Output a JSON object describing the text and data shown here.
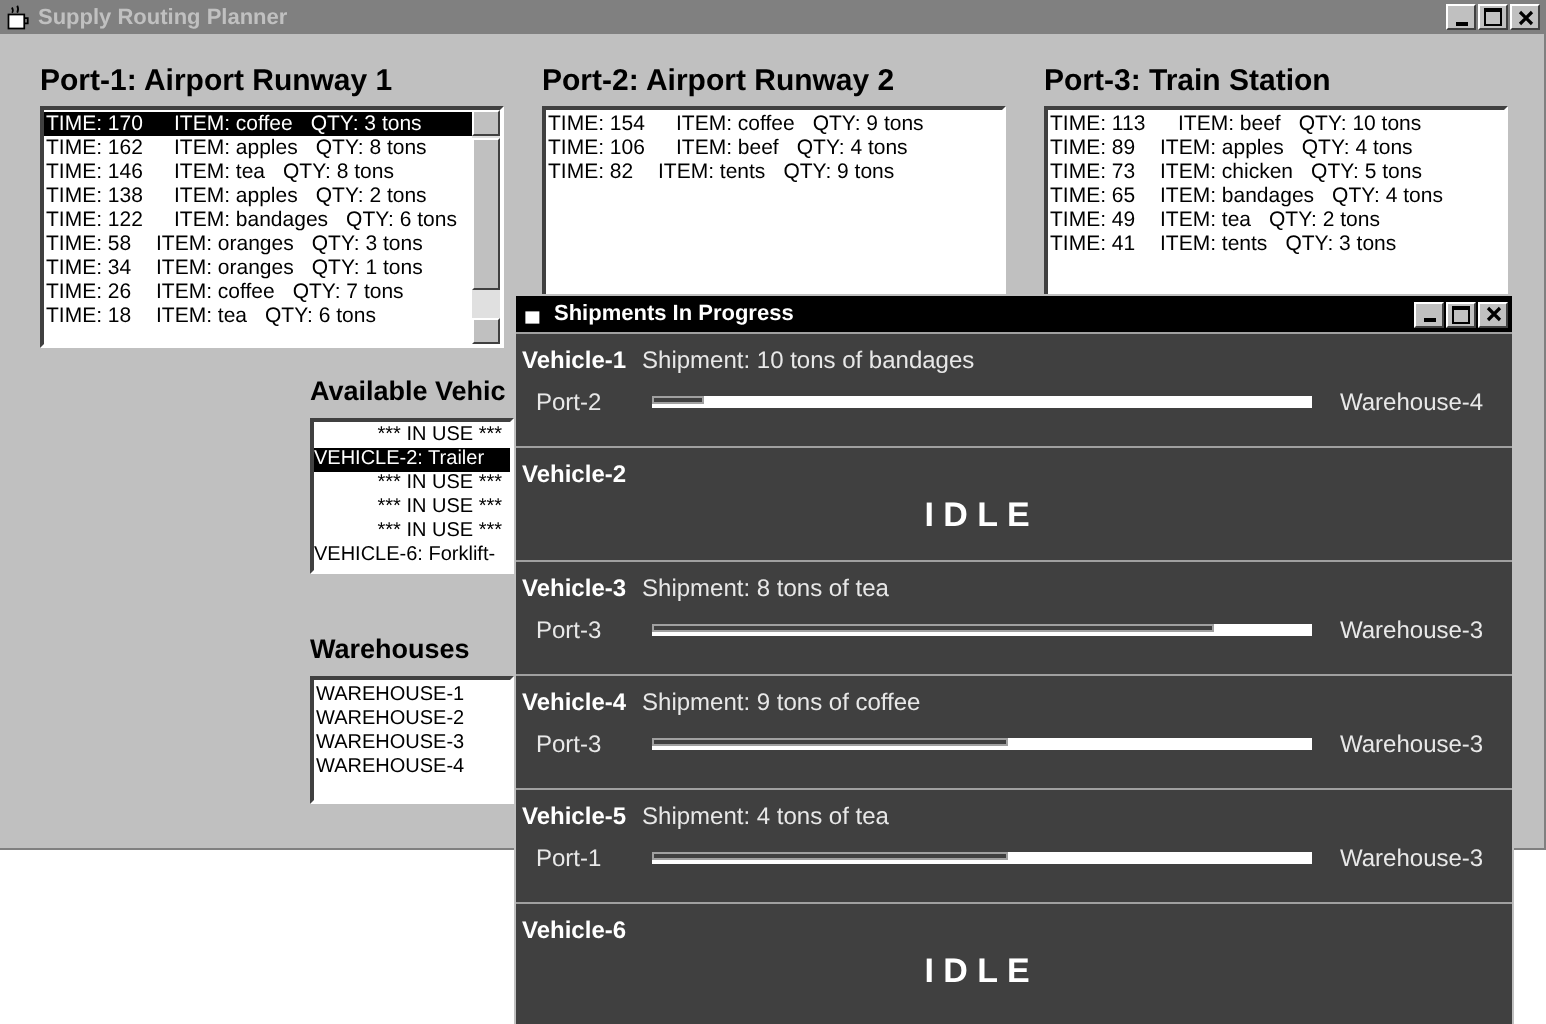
{
  "window": {
    "title": "Supply Routing Planner"
  },
  "ports": [
    {
      "title": "Port-1: Airport Runway 1",
      "scrollable": true,
      "rows": [
        {
          "time": "TIME: 170",
          "item": "ITEM: coffee",
          "qty": "QTY: 3 tons",
          "selected": true
        },
        {
          "time": "TIME: 162",
          "item": "ITEM: apples",
          "qty": "QTY: 8 tons",
          "selected": false
        },
        {
          "time": "TIME: 146",
          "item": "ITEM: tea",
          "qty": "QTY: 8 tons",
          "selected": false
        },
        {
          "time": "TIME: 138",
          "item": "ITEM: apples",
          "qty": "QTY: 2 tons",
          "selected": false
        },
        {
          "time": "TIME: 122",
          "item": "ITEM: bandages",
          "qty": "QTY: 6 tons",
          "selected": false
        },
        {
          "time": "TIME: 58",
          "item": "ITEM: oranges",
          "qty": "QTY: 3 tons",
          "selected": false
        },
        {
          "time": "TIME: 34",
          "item": "ITEM: oranges",
          "qty": "QTY: 1 tons",
          "selected": false
        },
        {
          "time": "TIME: 26",
          "item": "ITEM: coffee",
          "qty": "QTY: 7 tons",
          "selected": false
        },
        {
          "time": "TIME: 18",
          "item": "ITEM: tea",
          "qty": "QTY: 6 tons",
          "selected": false
        }
      ]
    },
    {
      "title": "Port-2: Airport Runway 2",
      "scrollable": false,
      "rows": [
        {
          "time": "TIME: 154",
          "item": "ITEM: coffee",
          "qty": "QTY: 9 tons",
          "selected": false
        },
        {
          "time": "TIME: 106",
          "item": "ITEM: beef",
          "qty": "QTY: 4 tons",
          "selected": false
        },
        {
          "time": "TIME: 82",
          "item": "ITEM: tents",
          "qty": "QTY: 9 tons",
          "selected": false
        }
      ]
    },
    {
      "title": "Port-3: Train Station",
      "scrollable": false,
      "rows": [
        {
          "time": "TIME: 113",
          "item": "ITEM: beef",
          "qty": "QTY: 10 tons",
          "selected": false
        },
        {
          "time": "TIME: 89",
          "item": "ITEM: apples",
          "qty": "QTY: 4 tons",
          "selected": false
        },
        {
          "time": "TIME: 73",
          "item": "ITEM: chicken",
          "qty": "QTY: 5 tons",
          "selected": false
        },
        {
          "time": "TIME: 65",
          "item": "ITEM: bandages",
          "qty": "QTY: 4 tons",
          "selected": false
        },
        {
          "time": "TIME: 49",
          "item": "ITEM: tea",
          "qty": "QTY: 2 tons",
          "selected": false
        },
        {
          "time": "TIME: 41",
          "item": "ITEM: tents",
          "qty": "QTY: 3 tons",
          "selected": false
        }
      ]
    }
  ],
  "vehicles": {
    "title": "Available Vehic",
    "items": [
      {
        "kind": "in_use",
        "label": "*** IN USE ***",
        "selected": false
      },
      {
        "kind": "vehicle",
        "label": "VEHICLE-2: Trailer",
        "selected": true
      },
      {
        "kind": "in_use",
        "label": "*** IN USE ***",
        "selected": false
      },
      {
        "kind": "in_use",
        "label": "*** IN USE ***",
        "selected": false
      },
      {
        "kind": "in_use",
        "label": "*** IN USE ***",
        "selected": false
      },
      {
        "kind": "vehicle",
        "label": "VEHICLE-6: Forklift-",
        "selected": false
      }
    ]
  },
  "warehouses": {
    "title": "Warehouses",
    "items": [
      "WAREHOUSE-1",
      "WAREHOUSE-2",
      "WAREHOUSE-3",
      "WAREHOUSE-4"
    ]
  },
  "shipments_window": {
    "title": "Shipments In Progress",
    "vehicles": [
      {
        "kind": "moving",
        "name": "Vehicle-1",
        "shipment": "Shipment: 10 tons of bandages",
        "from": "Port-2",
        "to": "Warehouse-4",
        "level": 0.08
      },
      {
        "kind": "idle",
        "name": "Vehicle-2",
        "status": "I D L E"
      },
      {
        "kind": "moving",
        "name": "Vehicle-3",
        "shipment": "Shipment: 8 tons of tea",
        "from": "Port-3",
        "to": "Warehouse-3",
        "level": 0.85
      },
      {
        "kind": "moving",
        "name": "Vehicle-4",
        "shipment": "Shipment: 9 tons of coffee",
        "from": "Port-3",
        "to": "Warehouse-3",
        "level": 0.54
      },
      {
        "kind": "moving",
        "name": "Vehicle-5",
        "shipment": "Shipment: 4 tons of tea",
        "from": "Port-1",
        "to": "Warehouse-3",
        "level": 0.54
      },
      {
        "kind": "idle",
        "name": "Vehicle-6",
        "status": "I D L E"
      }
    ]
  }
}
